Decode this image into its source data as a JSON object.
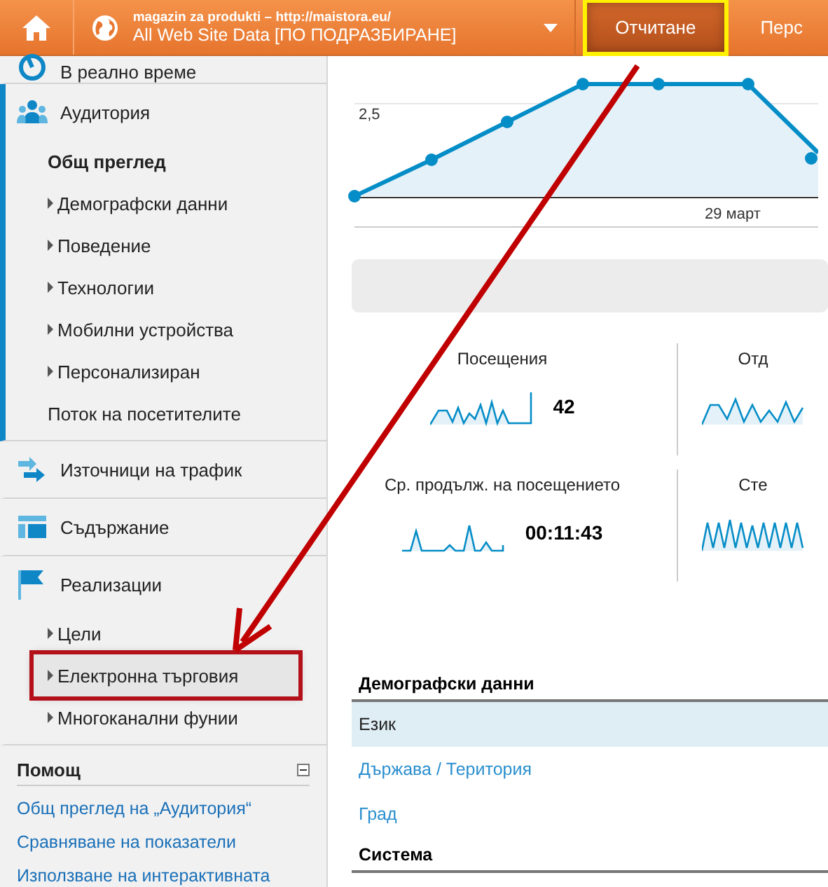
{
  "header": {
    "property": {
      "account": "magazin za produkti – http://maistora.eu/",
      "view": "All Web Site Data [ПО ПОДРАЗБИРАНЕ]"
    },
    "nav": [
      {
        "label": "Отчитане",
        "selected": true,
        "highlighted": true
      },
      {
        "label": "Перс",
        "selected": false,
        "highlighted": false
      }
    ]
  },
  "sidebar": {
    "sections": [
      {
        "label": "В реално време",
        "active": false
      },
      {
        "label": "Аудитория",
        "active": true,
        "children": [
          {
            "label": "Общ преглед",
            "selected": true,
            "expandable": false,
            "highlighted": false
          },
          {
            "label": "Демографски данни",
            "selected": false,
            "expandable": true,
            "highlighted": false
          },
          {
            "label": "Поведение",
            "selected": false,
            "expandable": true,
            "highlighted": false
          },
          {
            "label": "Технологии",
            "selected": false,
            "expandable": true,
            "highlighted": false
          },
          {
            "label": "Мобилни устройства",
            "selected": false,
            "expandable": true,
            "highlighted": false
          },
          {
            "label": "Персонализиран",
            "selected": false,
            "expandable": true,
            "highlighted": false
          },
          {
            "label": "Поток на посетителите",
            "selected": false,
            "expandable": false,
            "highlighted": false
          }
        ]
      },
      {
        "label": "Източници на трафик",
        "active": false
      },
      {
        "label": "Съдържание",
        "active": false
      },
      {
        "label": "Реализации",
        "active": false,
        "children": [
          {
            "label": "Цели",
            "selected": false,
            "expandable": true,
            "highlighted": false
          },
          {
            "label": "Електронна търговия",
            "selected": false,
            "expandable": true,
            "highlighted": true
          },
          {
            "label": "Многоканални фунии",
            "selected": false,
            "expandable": true,
            "highlighted": false
          }
        ]
      }
    ],
    "help": {
      "title": "Помощ",
      "links": [
        "Общ преглед на „Аудитория“",
        "Сравняване на показатели",
        "Използване на интерактивната"
      ]
    }
  },
  "chart": {
    "y_label": "2,5",
    "x_label": "29 март"
  },
  "metrics": [
    {
      "label": "Посещения",
      "value": "42"
    },
    {
      "label": "Отд"
    },
    {
      "label": "Ср. продълж. на посещението",
      "value": "00:11:43"
    },
    {
      "label": "Сте"
    }
  ],
  "table": {
    "groups": [
      {
        "title": "Демографски данни",
        "rows": [
          {
            "label": "Език",
            "selected": true
          },
          {
            "label": "Държава / Територия",
            "selected": false
          },
          {
            "label": "Град",
            "selected": false
          }
        ]
      },
      {
        "title": "Система"
      }
    ]
  }
}
